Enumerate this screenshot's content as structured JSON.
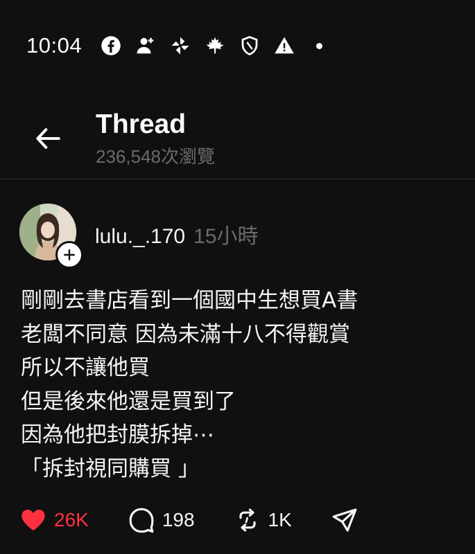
{
  "status_bar": {
    "time": "10:04",
    "icons": [
      "facebook-icon",
      "add-contact-icon",
      "pinwheel-icon",
      "maple-leaf-icon",
      "shield-icon",
      "warning-icon",
      "notification-dot"
    ]
  },
  "header": {
    "title": "Thread",
    "views": "236,548次瀏覽",
    "back_icon": "back-arrow-icon"
  },
  "post": {
    "username": "lulu._.170",
    "time_ago": "15小時",
    "lines": [
      "剛剛去書店看到一個國中生想買A書",
      "老闆不同意 因為未滿十八不得觀賞",
      "所以不讓他買",
      "但是後來他還是買到了",
      "因為他把封膜拆掉⋯",
      "「拆封視同購買 」"
    ],
    "actions": {
      "likes": "26K",
      "replies": "198",
      "reposts": "1K"
    }
  },
  "colors": {
    "background": "#101010",
    "text": "#f3f5f7",
    "muted": "#6b6b6b",
    "like": "#ff3040",
    "divider": "#2d2d2d"
  }
}
